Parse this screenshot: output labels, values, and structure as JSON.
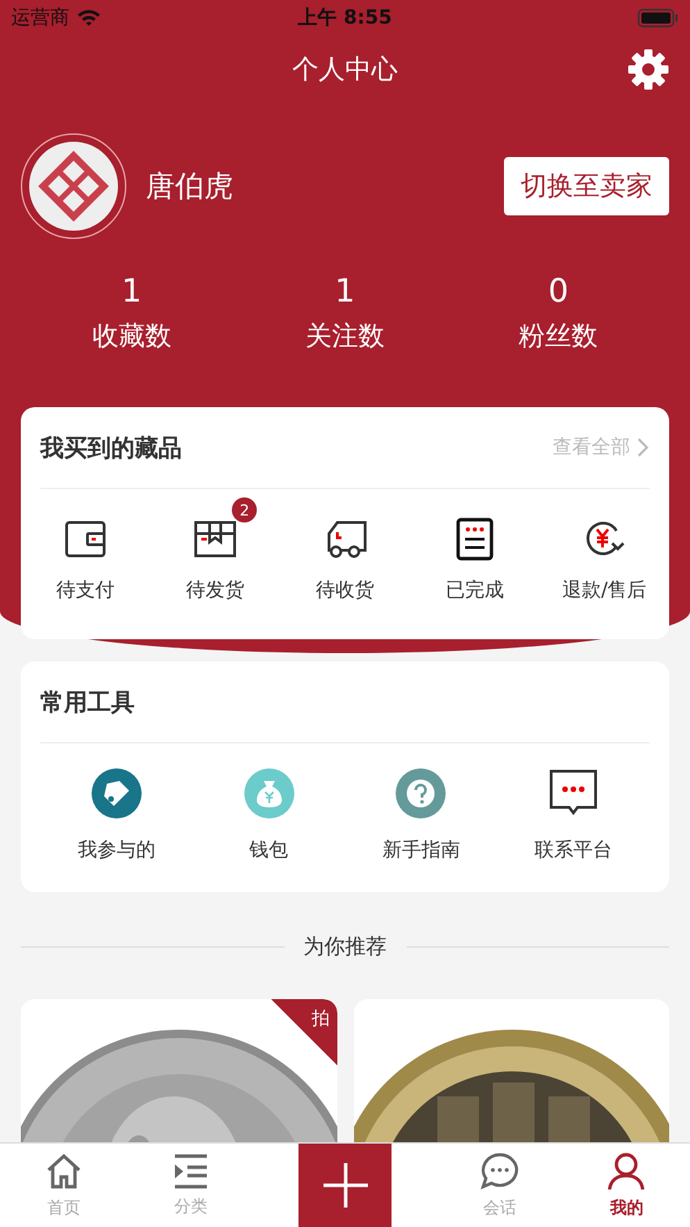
{
  "status_bar": {
    "carrier": "运营商",
    "time": "上午 8:55"
  },
  "title": "个人中心",
  "user": {
    "name": "唐伯虎",
    "switch_button": "切换至卖家"
  },
  "stats": [
    {
      "value": "1",
      "label": "收藏数"
    },
    {
      "value": "1",
      "label": "关注数"
    },
    {
      "value": "0",
      "label": "粉丝数"
    }
  ],
  "orders": {
    "title": "我买到的藏品",
    "view_all": "查看全部",
    "items": [
      {
        "label": "待支付"
      },
      {
        "label": "待发货",
        "badge": "2"
      },
      {
        "label": "待收货"
      },
      {
        "label": "已完成"
      },
      {
        "label": "退款/售后"
      }
    ]
  },
  "tools": {
    "title": "常用工具",
    "items": [
      {
        "label": "我参与的",
        "color": "#18758a"
      },
      {
        "label": "钱包",
        "color": "#6ccbcb"
      },
      {
        "label": "新手指南",
        "color": "#649a9a"
      },
      {
        "label": "联系平台"
      }
    ]
  },
  "recommend_title": "为你推荐",
  "products": [
    {
      "kind": "picture",
      "tag": "拍"
    },
    {
      "kind": "picture"
    }
  ],
  "tab_bar": [
    {
      "label": "首页",
      "selected": false
    },
    {
      "label": "分类",
      "selected": false
    },
    {
      "kind": "plus"
    },
    {
      "label": "会话",
      "selected": false
    },
    {
      "label": "我的",
      "selected": true
    }
  ]
}
